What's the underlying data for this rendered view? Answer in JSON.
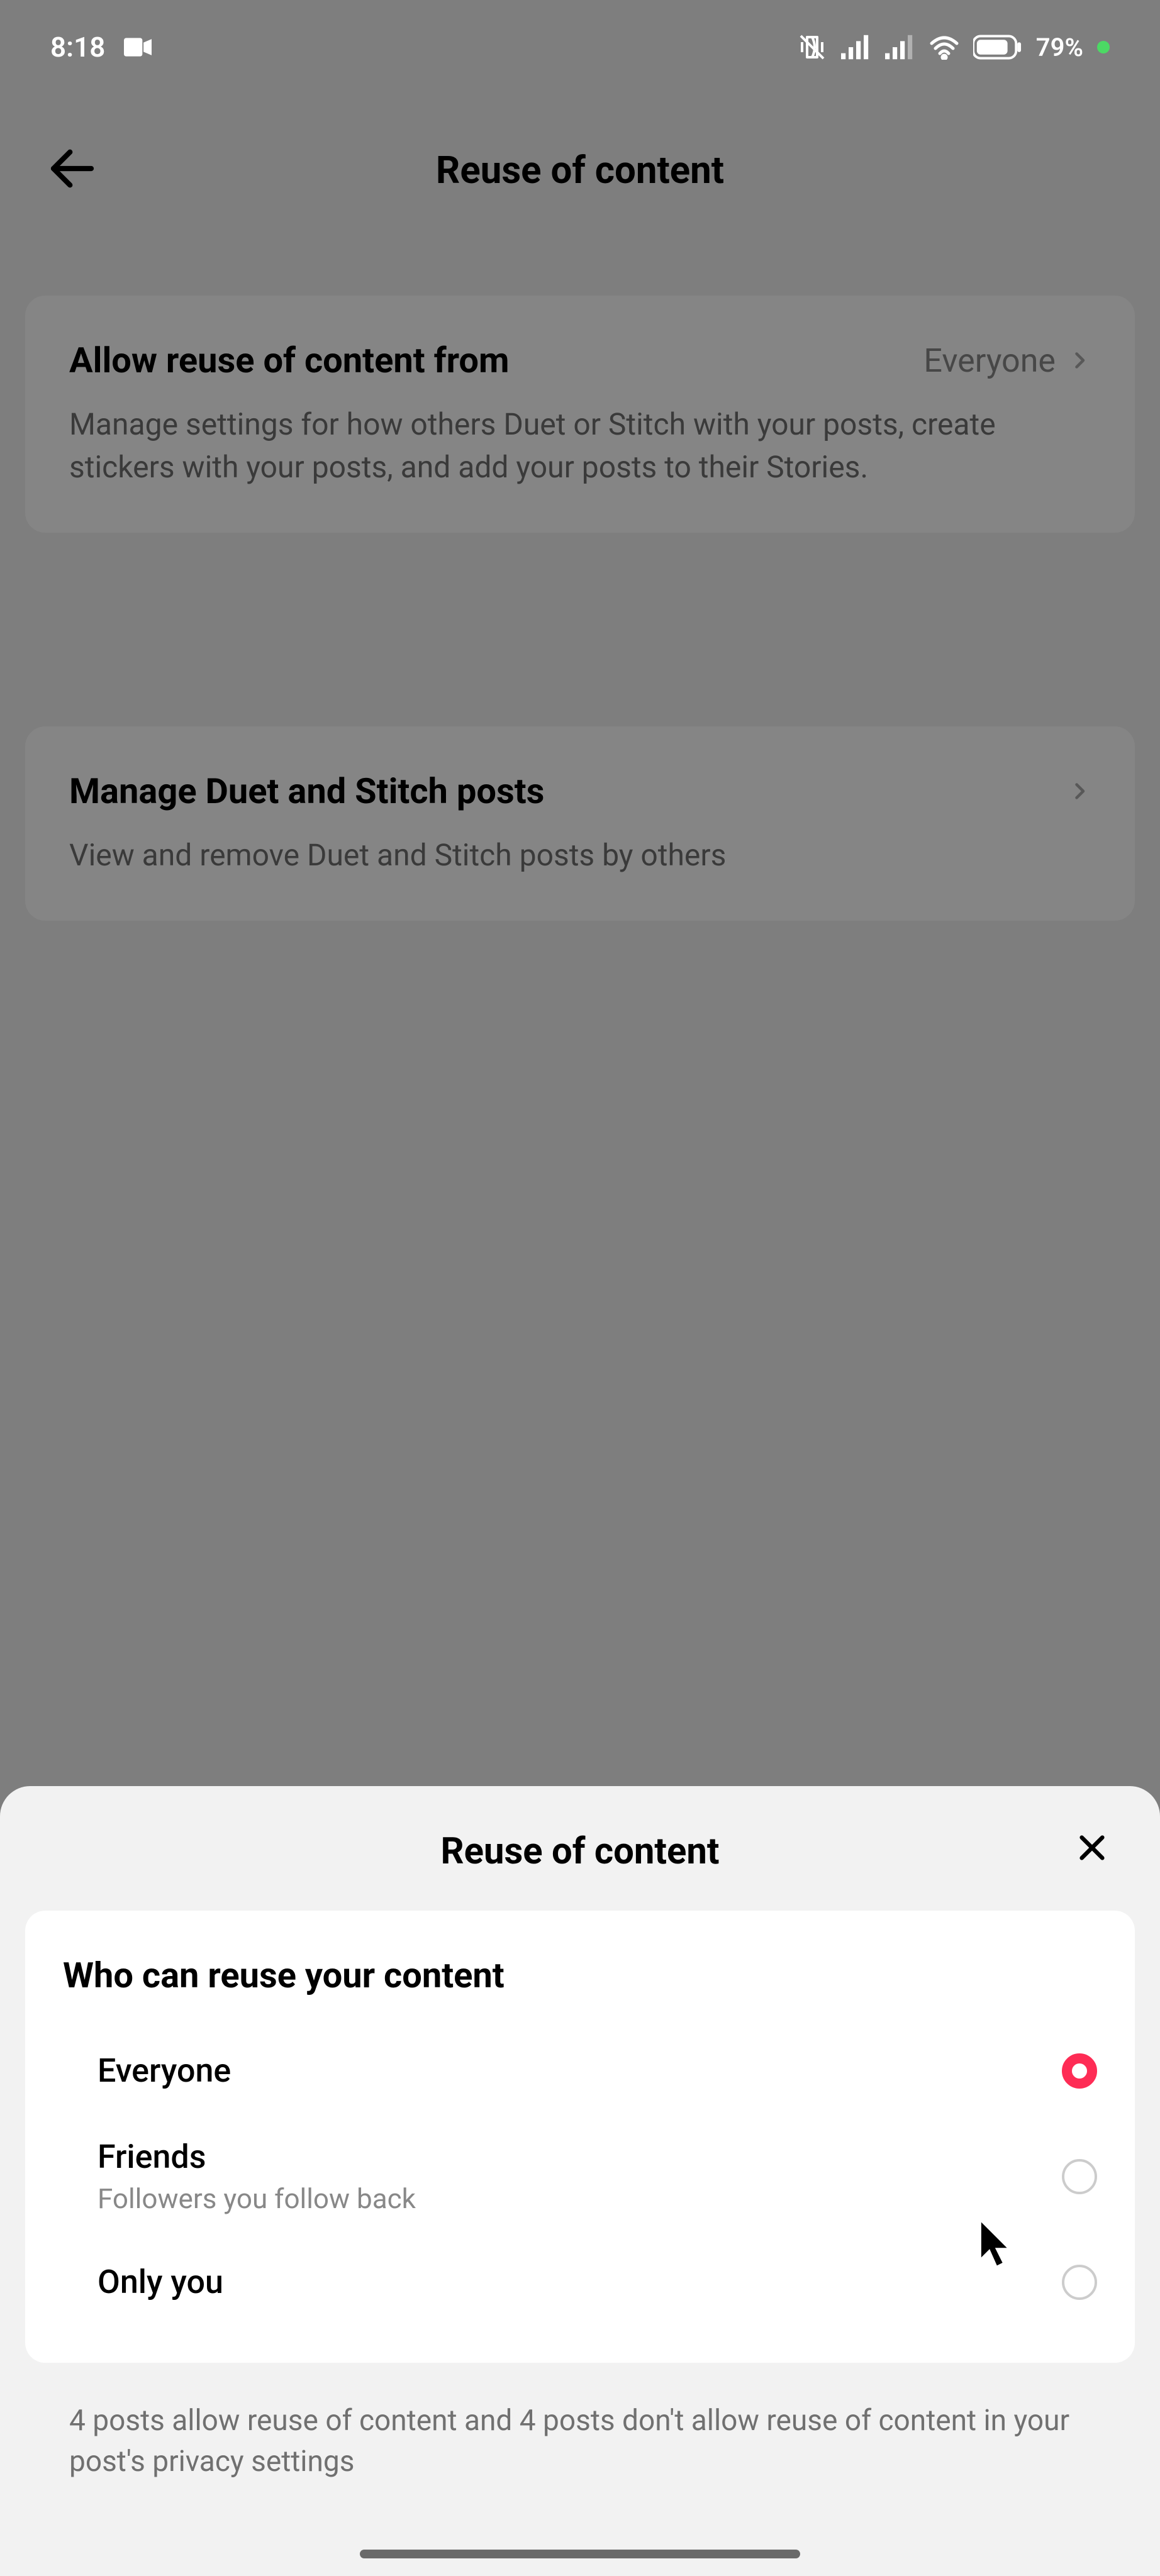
{
  "statusbar": {
    "time": "8:18",
    "battery": "79%"
  },
  "header": {
    "title": "Reuse of content"
  },
  "cards": {
    "allow": {
      "title": "Allow reuse of content from",
      "value": "Everyone",
      "desc": "Manage settings for how others Duet or Stitch with your posts, create stickers with your posts, and add your posts to their Stories."
    },
    "manage": {
      "title": "Manage Duet and Stitch posts",
      "desc": "View and remove Duet and Stitch posts by others"
    }
  },
  "sheet": {
    "title": "Reuse of content",
    "subtitle": "Who can reuse your content",
    "options": [
      {
        "label": "Everyone",
        "sub": ""
      },
      {
        "label": "Friends",
        "sub": "Followers you follow back"
      },
      {
        "label": "Only you",
        "sub": ""
      }
    ],
    "footer": "4 posts allow reuse of content and 4 posts don't allow reuse of content in your post's privacy settings"
  }
}
